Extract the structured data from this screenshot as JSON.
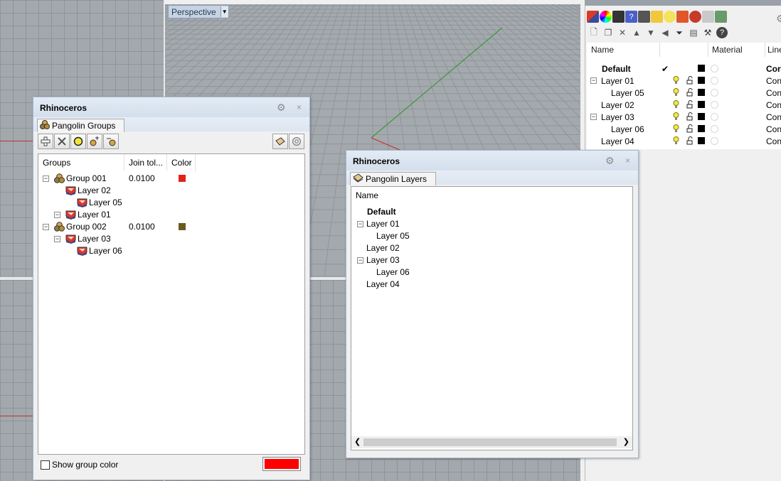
{
  "viewport": {
    "label": "Perspective"
  },
  "right_panel": {
    "columns": {
      "name": "Name",
      "material": "Material",
      "linetype": "Line"
    },
    "layers": [
      {
        "name": "Default",
        "bold": true,
        "current": "✔",
        "indent": 0,
        "expander": "",
        "linetype": "Cor"
      },
      {
        "name": "Layer 01",
        "bold": false,
        "current": "",
        "indent": 0,
        "expander": "−",
        "linetype": "Cont"
      },
      {
        "name": "Layer 05",
        "bold": false,
        "current": "",
        "indent": 1,
        "expander": "",
        "linetype": "Cont"
      },
      {
        "name": "Layer 02",
        "bold": false,
        "current": "",
        "indent": 0,
        "expander": "",
        "linetype": "Cont"
      },
      {
        "name": "Layer 03",
        "bold": false,
        "current": "",
        "indent": 0,
        "expander": "−",
        "linetype": "Cont"
      },
      {
        "name": "Layer 06",
        "bold": false,
        "current": "",
        "indent": 1,
        "expander": "",
        "linetype": "Cont"
      },
      {
        "name": "Layer 04",
        "bold": false,
        "current": "",
        "indent": 0,
        "expander": "",
        "linetype": "Cont"
      }
    ]
  },
  "groups_window": {
    "title": "Rhinoceros",
    "tab": "Pangolin Groups",
    "columns": {
      "groups": "Groups",
      "join_tol": "Join tol...",
      "color": "Color"
    },
    "rows": [
      {
        "label": "Group 001",
        "type": "group",
        "expander": "−",
        "join_tol": "0.0100",
        "color": "#e0241a"
      },
      {
        "label": "Layer 02",
        "type": "layer",
        "expander": "",
        "join_tol": "",
        "color": ""
      },
      {
        "label": "Layer 05",
        "type": "layer",
        "expander": "",
        "join_tol": "",
        "color": ""
      },
      {
        "label": "Layer 01",
        "type": "layer",
        "expander": "−",
        "join_tol": "",
        "color": ""
      },
      {
        "label": "Group 002",
        "type": "group",
        "expander": "−",
        "join_tol": "0.0100",
        "color": "#6b5a1e"
      },
      {
        "label": "Layer 03",
        "type": "layer",
        "expander": "−",
        "join_tol": "",
        "color": ""
      },
      {
        "label": "Layer 06",
        "type": "layer",
        "expander": "",
        "join_tol": "",
        "color": ""
      }
    ],
    "show_group_color_label": "Show group color",
    "show_group_color_checked": false,
    "swatch_color": "#ff0000"
  },
  "layers_window": {
    "title": "Rhinoceros",
    "tab": "Pangolin Layers",
    "column": "Name",
    "rows": [
      {
        "label": "Default",
        "bold": true,
        "expander": ""
      },
      {
        "label": "Layer 01",
        "bold": false,
        "expander": "−"
      },
      {
        "label": "Layer 05",
        "bold": false,
        "expander": ""
      },
      {
        "label": "Layer 02",
        "bold": false,
        "expander": ""
      },
      {
        "label": "Layer 03",
        "bold": false,
        "expander": "−"
      },
      {
        "label": "Layer 06",
        "bold": false,
        "expander": ""
      },
      {
        "label": "Layer 04",
        "bold": false,
        "expander": ""
      }
    ]
  },
  "icons": [
    "gear-icon",
    "close-icon",
    "add-icon",
    "delete-icon",
    "layer-icon",
    "group-icon",
    "filter-icon",
    "help-icon",
    "bulb-icon",
    "lock-icon"
  ]
}
